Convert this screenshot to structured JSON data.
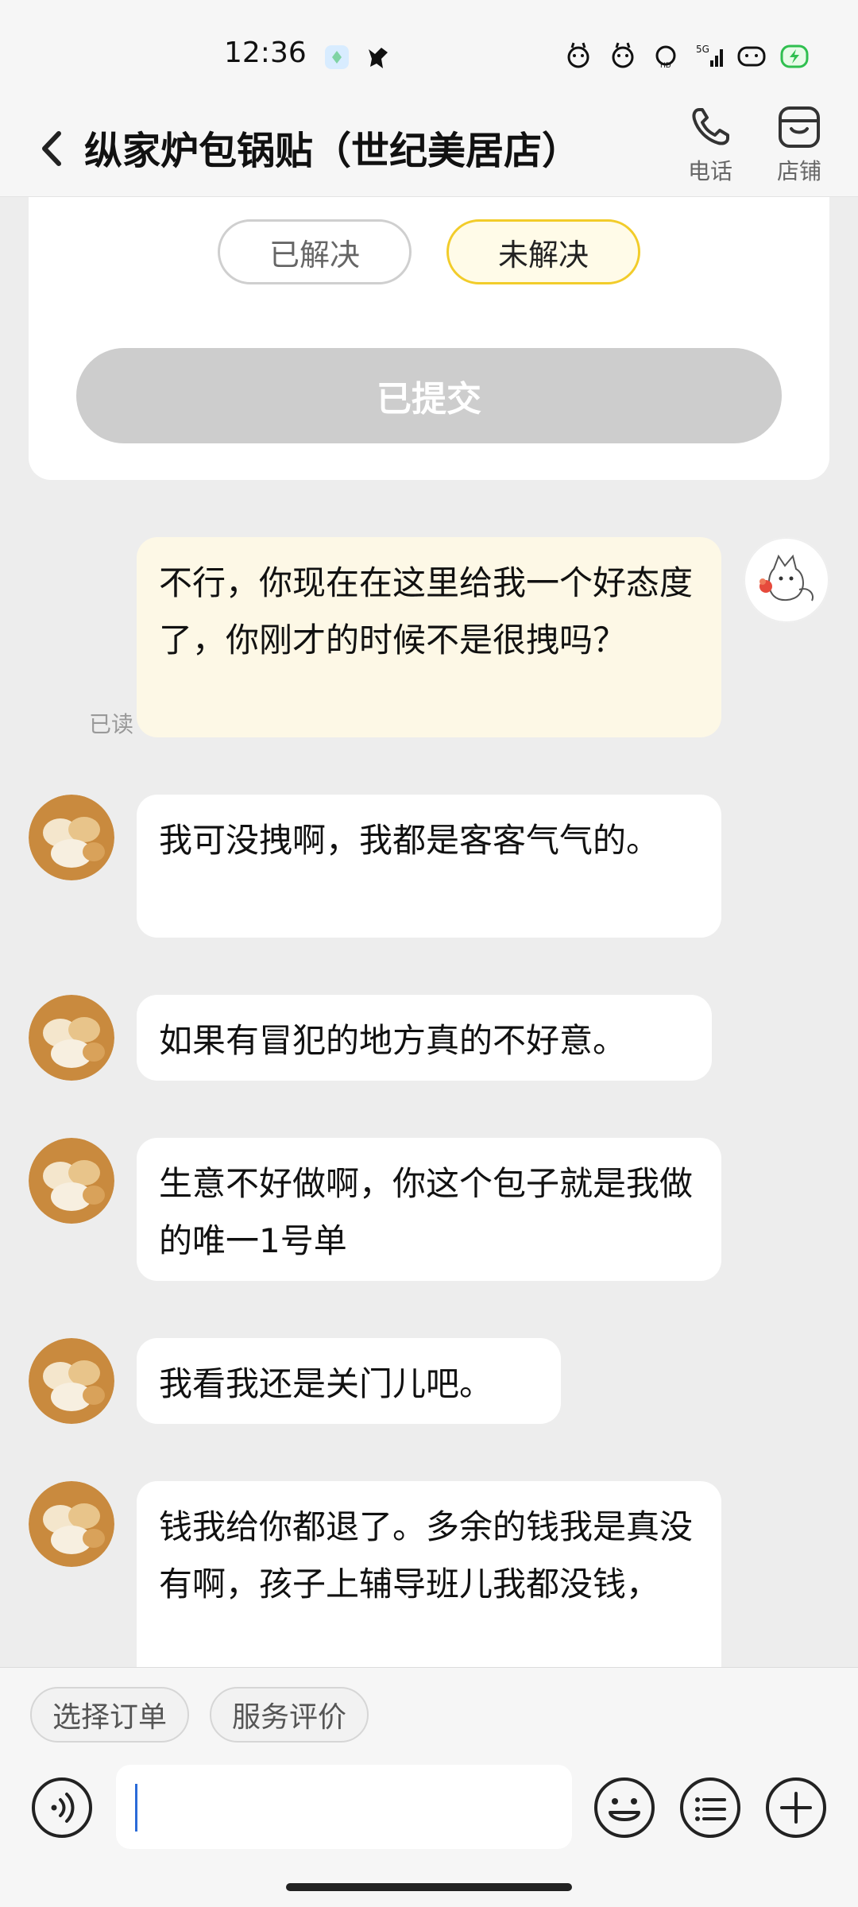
{
  "status_bar": {
    "time": "12:36"
  },
  "header": {
    "title": "纵家炉包锅贴（世纪美居店）",
    "actions": [
      {
        "label": "电话",
        "icon": "phone-icon"
      },
      {
        "label": "店铺",
        "icon": "store-icon"
      }
    ]
  },
  "feedback": {
    "resolved_label": "已解决",
    "unresolved_label": "未解决",
    "submit_label": "已提交"
  },
  "messages": [
    {
      "from": "me",
      "text": "不行，你现在在这里给我一个好态度了，你刚才的时候不是很拽吗？",
      "read": "已读"
    },
    {
      "from": "shop",
      "text": "我可没拽啊，我都是客客气气的。"
    },
    {
      "from": "shop",
      "text": "如果有冒犯的地方真的不好意。"
    },
    {
      "from": "shop",
      "text": "生意不好做啊，你这个包子就是我做的唯一1号单"
    },
    {
      "from": "shop",
      "text": "我看我还是关门儿吧。"
    },
    {
      "from": "shop",
      "text": "钱我给你都退了。多余的钱我是真没有啊，孩子上辅导班儿我都没钱，"
    }
  ],
  "bottom_bar": {
    "chips": [
      "选择订单",
      "服务评价"
    ],
    "input_value": "",
    "tools": [
      "voice-icon",
      "emoji-icon",
      "quick-reply-icon",
      "plus-icon"
    ]
  },
  "colors": {
    "background": "#ededed",
    "my_bubble": "#fdf8e6",
    "their_bubble": "#ffffff",
    "accent_yellow": "#f2cc2a",
    "submitted_gray": "#cdcdcd"
  }
}
